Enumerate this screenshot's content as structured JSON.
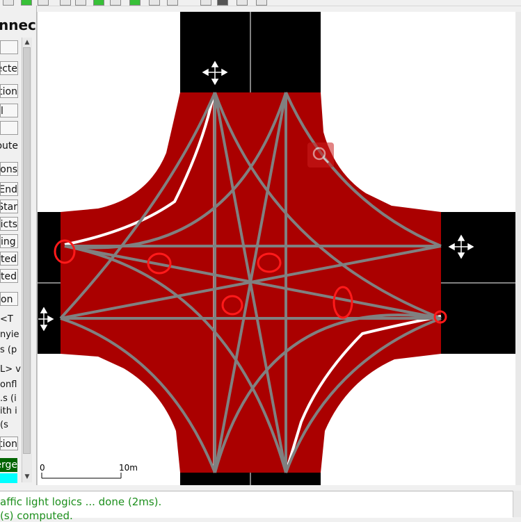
{
  "toolbar": {
    "buttons": [
      "select-icon",
      "add-icon",
      "pointer-icon",
      "lock-icon",
      "green-icon",
      "line-icon",
      "green-line-icon",
      "grid-icon",
      "marker-icon",
      "dark-icon",
      "move-icon",
      "close-icon"
    ]
  },
  "panel": {
    "title": "nnec",
    "items": [
      "ecte",
      "tion",
      "l",
      "",
      "oute",
      "ons",
      "End",
      "Star",
      "icts",
      "ing",
      "ted",
      "ted",
      "on",
      "T>",
      "nyie",
      "s (p",
      "L> v",
      "onfl",
      "s (i.",
      "ith i",
      "s)",
      "tion",
      "erge",
      ""
    ]
  },
  "colors": {
    "road": "#aa0000",
    "edge_end": "#000000",
    "connection": "#808080",
    "lane_marking": "#ffffff",
    "conflict_marker": "#ff1a1a",
    "green_box": "#006400",
    "cyan_box": "#00ffff",
    "log_text": "#1c8f1c"
  },
  "scale": {
    "zero_label": "0",
    "ten_label": "10m"
  },
  "log": {
    "lines": [
      "affic light logics ... done (2ms).",
      "(s) computed."
    ]
  },
  "icons": {
    "zoom": "magnifier-icon",
    "move": "move-arrows-icon"
  }
}
